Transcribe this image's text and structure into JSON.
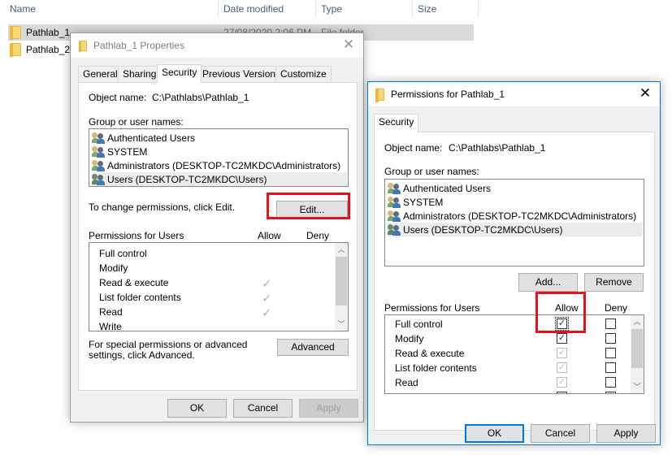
{
  "explorer": {
    "columns": [
      "Name",
      "Date modified",
      "Type",
      "Size"
    ],
    "files": [
      {
        "name": "Pathlab_1",
        "date": "27/08/2020 2:06 PM",
        "type": "File folder",
        "selected": true
      },
      {
        "name": "Pathlab_2",
        "date": "",
        "type": "",
        "selected": false
      }
    ]
  },
  "properties_dialog": {
    "title": "Pathlab_1 Properties",
    "tabs": [
      "General",
      "Sharing",
      "Security",
      "Previous Versions",
      "Customize"
    ],
    "active_tab": "Security",
    "object_name_label": "Object name:",
    "object_name_value": "C:\\Pathlabs\\Pathlab_1",
    "group_label": "Group or user names:",
    "users": [
      "Authenticated Users",
      "SYSTEM",
      "Administrators (DESKTOP-TC2MKDC\\Administrators)",
      "Users (DESKTOP-TC2MKDC\\Users)"
    ],
    "selected_user_index": 3,
    "change_hint": "To change permissions, click Edit.",
    "edit_button": "Edit...",
    "perm_header": "Permissions for Users",
    "allow_header": "Allow",
    "deny_header": "Deny",
    "permissions": [
      {
        "name": "Full control",
        "allow": false,
        "deny": false
      },
      {
        "name": "Modify",
        "allow": false,
        "deny": false
      },
      {
        "name": "Read & execute",
        "allow": true,
        "deny": false
      },
      {
        "name": "List folder contents",
        "allow": true,
        "deny": false
      },
      {
        "name": "Read",
        "allow": true,
        "deny": false
      },
      {
        "name": "Write",
        "allow": false,
        "deny": false
      }
    ],
    "advanced_hint": "For special permissions or advanced settings, click Advanced.",
    "advanced_button": "Advanced",
    "ok_button": "OK",
    "cancel_button": "Cancel",
    "apply_button": "Apply"
  },
  "permissions_dialog": {
    "title": "Permissions for Pathlab_1",
    "tab": "Security",
    "object_name_label": "Object name:",
    "object_name_value": "C:\\Pathlabs\\Pathlab_1",
    "group_label": "Group or user names:",
    "users": [
      "Authenticated Users",
      "SYSTEM",
      "Administrators (DESKTOP-TC2MKDC\\Administrators)",
      "Users (DESKTOP-TC2MKDC\\Users)"
    ],
    "selected_user_index": 3,
    "add_button": "Add...",
    "remove_button": "Remove",
    "perm_header": "Permissions for Users",
    "allow_header": "Allow",
    "deny_header": "Deny",
    "permissions": [
      {
        "name": "Full control",
        "allow": true,
        "allow_inherited": false,
        "deny": false
      },
      {
        "name": "Modify",
        "allow": true,
        "allow_inherited": false,
        "deny": false
      },
      {
        "name": "Read & execute",
        "allow": true,
        "allow_inherited": true,
        "deny": false
      },
      {
        "name": "List folder contents",
        "allow": true,
        "allow_inherited": true,
        "deny": false
      },
      {
        "name": "Read",
        "allow": true,
        "allow_inherited": true,
        "deny": false
      }
    ],
    "ok_button": "OK",
    "cancel_button": "Cancel",
    "apply_button": "Apply"
  },
  "highlight_color": "#e8101a",
  "accent_color": "#0078d7"
}
